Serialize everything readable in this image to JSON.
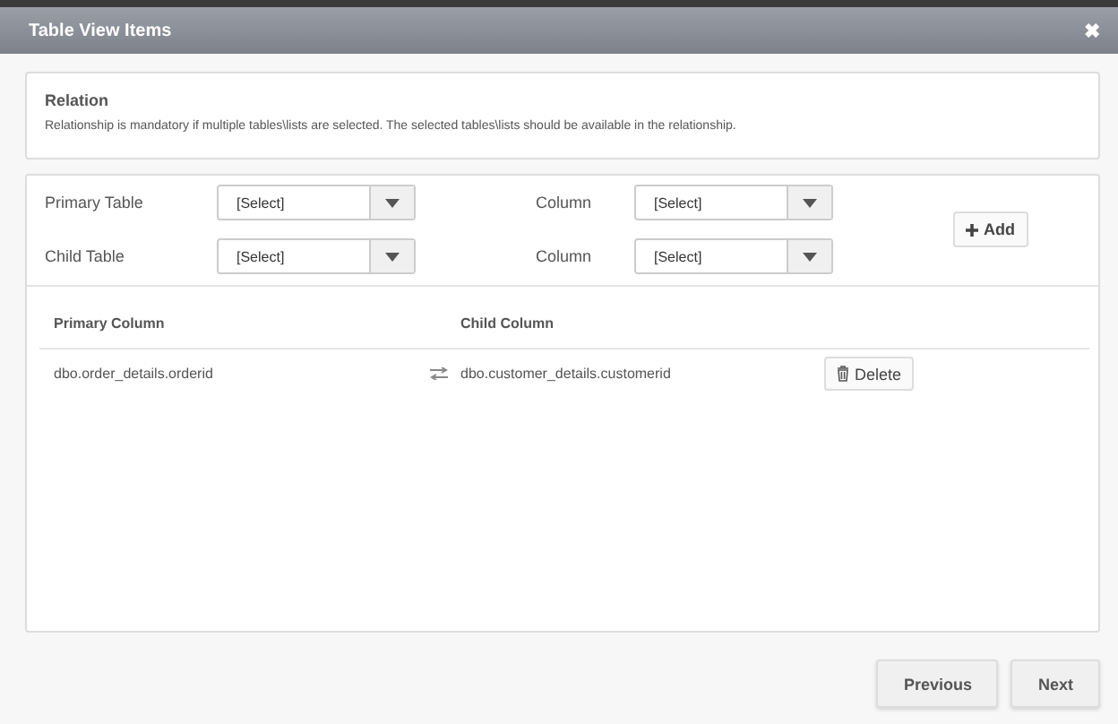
{
  "window": {
    "title": "Table View Items",
    "close": "✖"
  },
  "relation": {
    "heading": "Relation",
    "note": "Relationship is mandatory if multiple tables\\lists are selected. The selected tables\\lists should be available in the relationship."
  },
  "form": {
    "rows": [
      {
        "label": "Primary Table",
        "value": "[Select]",
        "column_label": "Column",
        "column_value": "[Select]"
      },
      {
        "label": "Child Table",
        "value": "[Select]",
        "column_label": "Column",
        "column_value": "[Select]"
      }
    ],
    "add_button": "Add"
  },
  "table": {
    "columns": [
      "Primary Column",
      "Child Column"
    ],
    "rows": [
      {
        "primary": "dbo.order_details.orderid",
        "child": "dbo.customer_details.customerid",
        "action": "Delete"
      }
    ]
  },
  "buttons": [
    "Previous",
    "Next"
  ]
}
